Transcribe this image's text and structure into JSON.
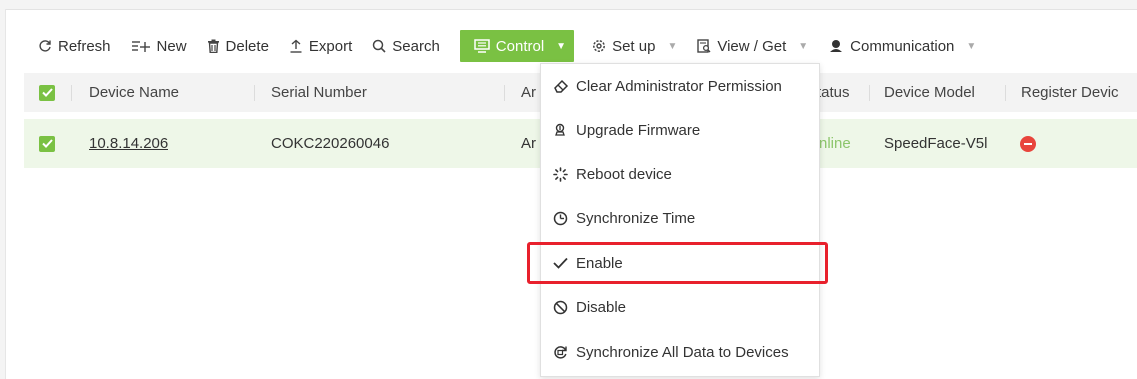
{
  "toolbar": {
    "refresh": "Refresh",
    "new": "New",
    "delete": "Delete",
    "export": "Export",
    "search": "Search",
    "control": "Control",
    "setup": "Set up",
    "view_get": "View / Get",
    "communication": "Communication"
  },
  "table": {
    "headers": {
      "device_name": "Device Name",
      "serial_number": "Serial Number",
      "area_partial": "Ar",
      "status_partial": "tatus",
      "device_model": "Device Model",
      "register_device_partial": "Register Devic"
    },
    "rows": [
      {
        "device_name": "10.8.14.206",
        "serial_number": "COKC220260046",
        "area_partial": "Ar",
        "status_partial": "nline",
        "device_model": "SpeedFace-V5l"
      }
    ]
  },
  "control_menu": {
    "items": [
      {
        "label": "Clear Administrator Permission",
        "icon": "eraser-icon"
      },
      {
        "label": "Upgrade Firmware",
        "icon": "upgrade-icon"
      },
      {
        "label": "Reboot device",
        "icon": "spinner-icon"
      },
      {
        "label": "Synchronize Time",
        "icon": "clock-sync-icon"
      },
      {
        "label": "Enable",
        "icon": "check-icon"
      },
      {
        "label": "Disable",
        "icon": "ban-icon"
      },
      {
        "label": "Synchronize All Data to Devices",
        "icon": "sync-data-icon"
      }
    ],
    "highlighted": "Enable"
  },
  "colors": {
    "accent": "#7ac143",
    "online": "#8cc56b",
    "row_selected": "#eef7e8",
    "header_bg": "#f3f3f3",
    "highlight_border": "#e8202c",
    "status_error": "#e8453c"
  }
}
